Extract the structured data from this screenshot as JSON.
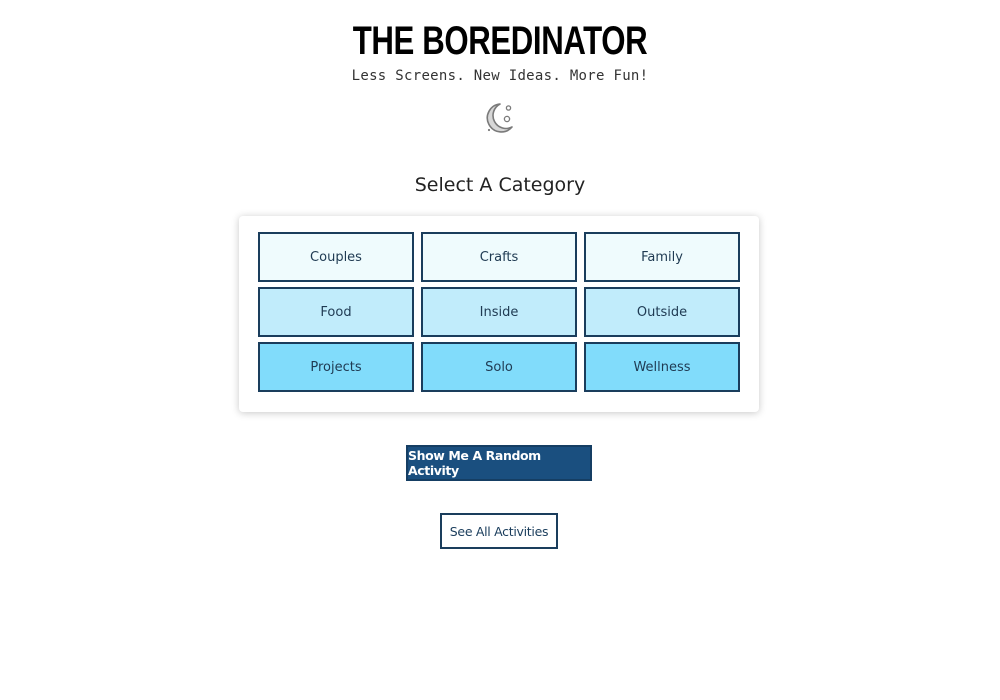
{
  "header": {
    "title": "THE BOREDINATOR",
    "tagline": "Less Screens. New Ideas. More Fun!"
  },
  "theme_toggle": {
    "icon": "moon-stars-icon"
  },
  "categories": {
    "heading": "Select A Category",
    "items": [
      {
        "label": "Couples"
      },
      {
        "label": "Crafts"
      },
      {
        "label": "Family"
      },
      {
        "label": "Food"
      },
      {
        "label": "Inside"
      },
      {
        "label": "Outside"
      },
      {
        "label": "Projects"
      },
      {
        "label": "Solo"
      },
      {
        "label": "Wellness"
      }
    ],
    "row_colors": [
      "#effbfd",
      "#c1ecfb",
      "#81dcfb"
    ],
    "border_color": "#1a3d5c"
  },
  "actions": {
    "random_label": "Show Me A Random Activity",
    "random_color": "#1a4f7f",
    "all_label": "See All Activities"
  }
}
